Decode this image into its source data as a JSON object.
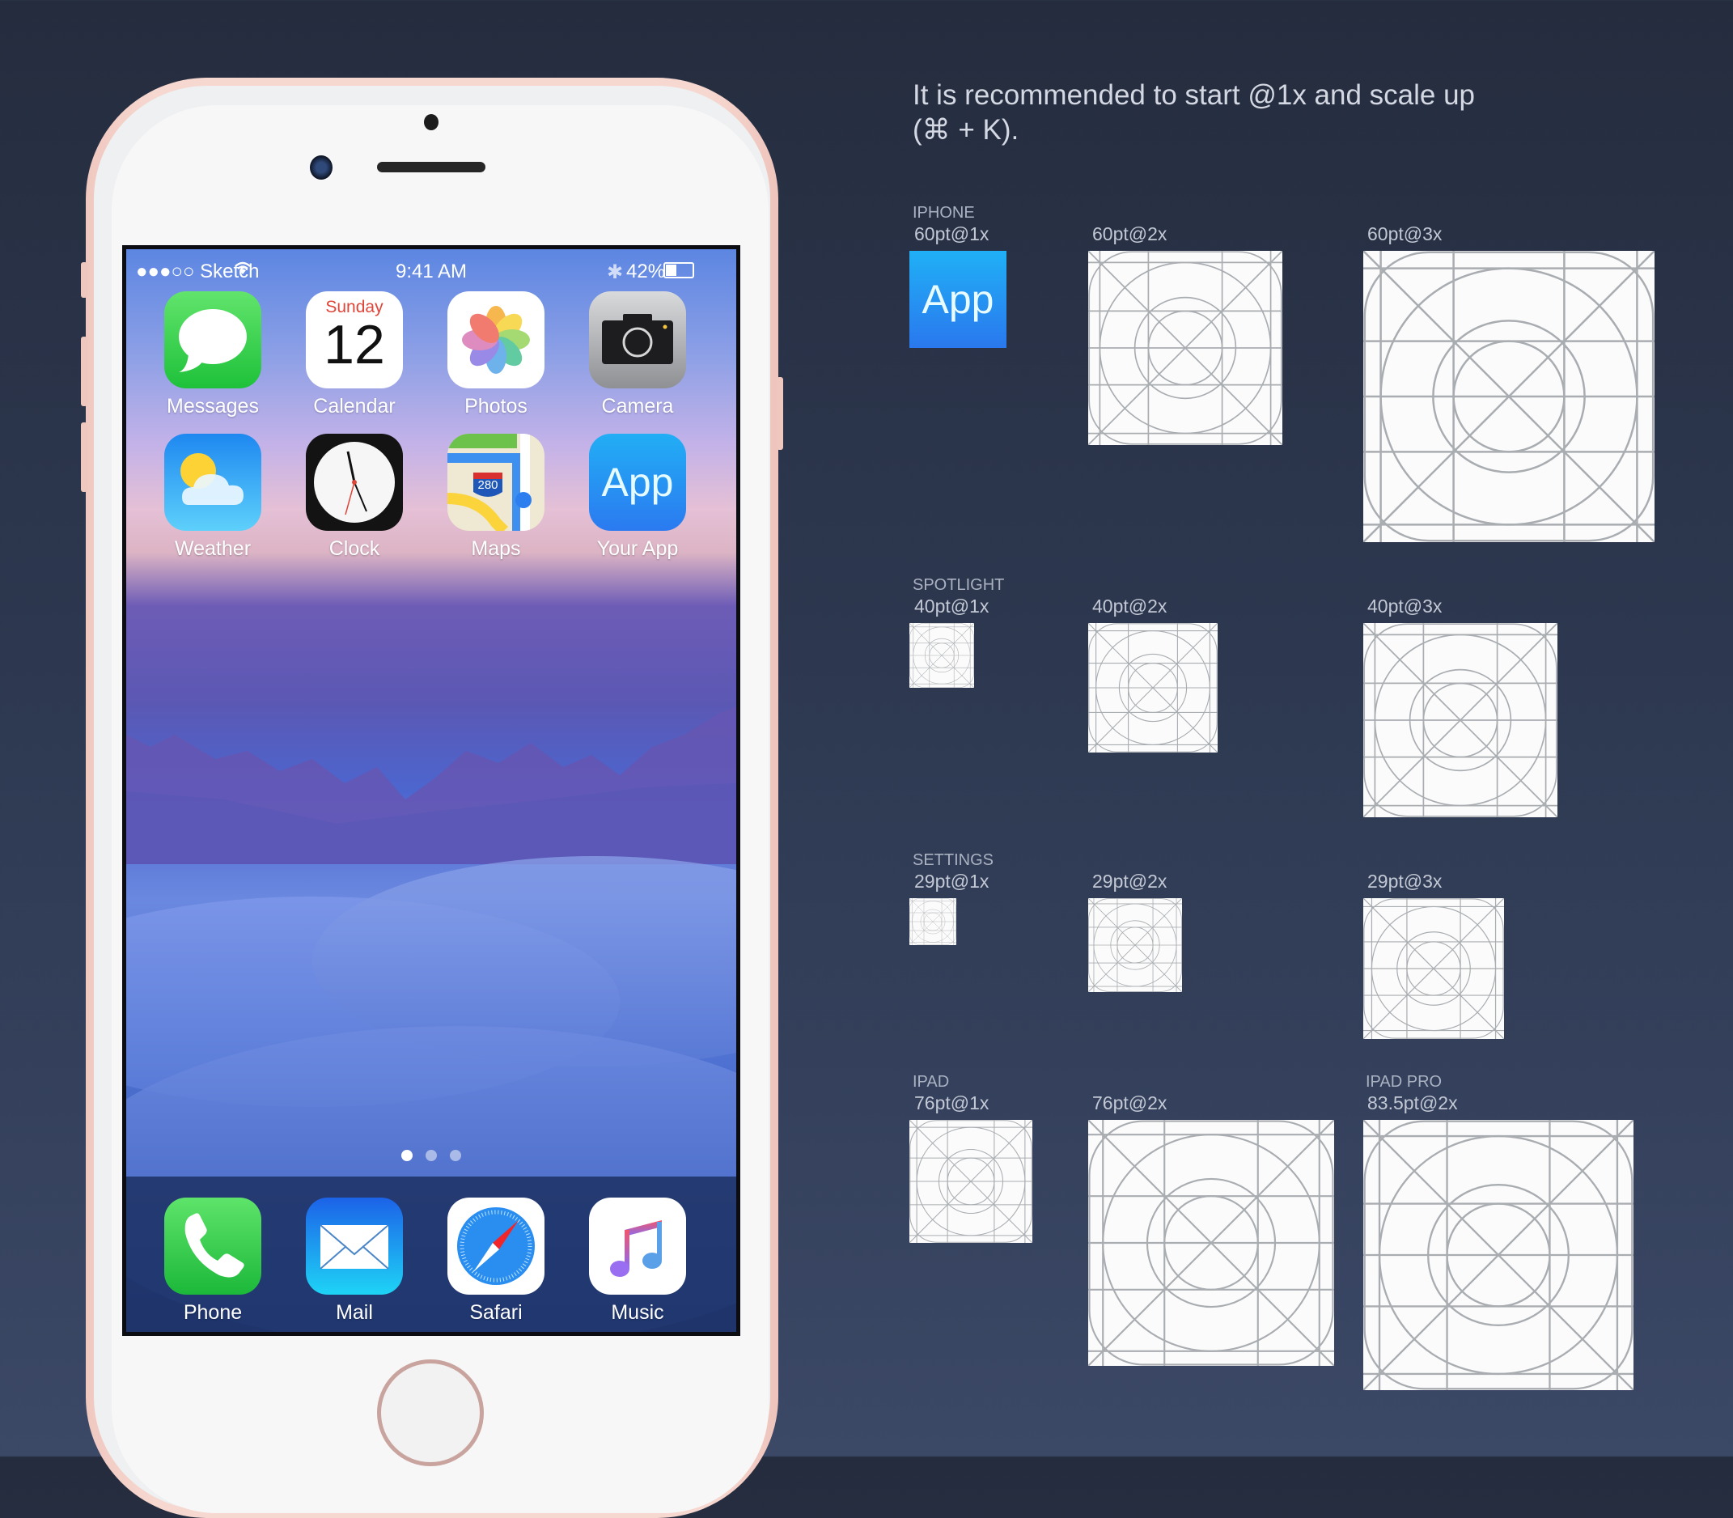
{
  "phone": {
    "status_bar": {
      "carrier": "●●●○○ Sketch",
      "time": "9:41 AM",
      "battery": "42%",
      "battery_level": 0.42
    },
    "home_apps": [
      {
        "label": "Messages",
        "icon": "messages-icon"
      },
      {
        "label": "Calendar",
        "icon": "calendar-icon",
        "day_name": "Sunday",
        "day_number": "12"
      },
      {
        "label": "Photos",
        "icon": "photos-icon"
      },
      {
        "label": "Camera",
        "icon": "camera-icon"
      },
      {
        "label": "Weather",
        "icon": "weather-icon"
      },
      {
        "label": "Clock",
        "icon": "clock-icon"
      },
      {
        "label": "Maps",
        "icon": "maps-icon",
        "shield": "280"
      },
      {
        "label": "Your App",
        "icon": "app-icon",
        "glyph": "App"
      }
    ],
    "page_dots": {
      "count": 3,
      "active": 1
    },
    "dock_apps": [
      {
        "label": "Phone",
        "icon": "phone-icon"
      },
      {
        "label": "Mail",
        "icon": "mail-icon"
      },
      {
        "label": "Safari",
        "icon": "safari-icon"
      },
      {
        "label": "Music",
        "icon": "music-icon"
      }
    ]
  },
  "panel": {
    "heading_line1": "It is recommended to start @1x and scale up",
    "heading_line2": "(⌘ + K).",
    "sections": [
      {
        "category": "IPHONE",
        "sizes": [
          "60pt@1x",
          "60pt@2x",
          "60pt@3x"
        ],
        "first_is_app": true,
        "app_glyph": "App"
      },
      {
        "category": "SPOTLIGHT",
        "sizes": [
          "40pt@1x",
          "40pt@2x",
          "40pt@3x"
        ]
      },
      {
        "category": "SETTINGS",
        "sizes": [
          "29pt@1x",
          "29pt@2x",
          "29pt@3x"
        ]
      },
      {
        "category": "IPAD",
        "sizes": [
          "76pt@1x",
          "76pt@2x"
        ],
        "extra_category": "IPAD PRO",
        "extra_size": "83.5pt@2x"
      }
    ]
  },
  "colors": {
    "background_top": "#252c3e",
    "background_bottom": "#3b4866",
    "phone_body": "#f6d8d0",
    "template_lines": "#a9adb1",
    "app_blue_top": "#20b0f6",
    "app_blue_bottom": "#2a78ee"
  }
}
